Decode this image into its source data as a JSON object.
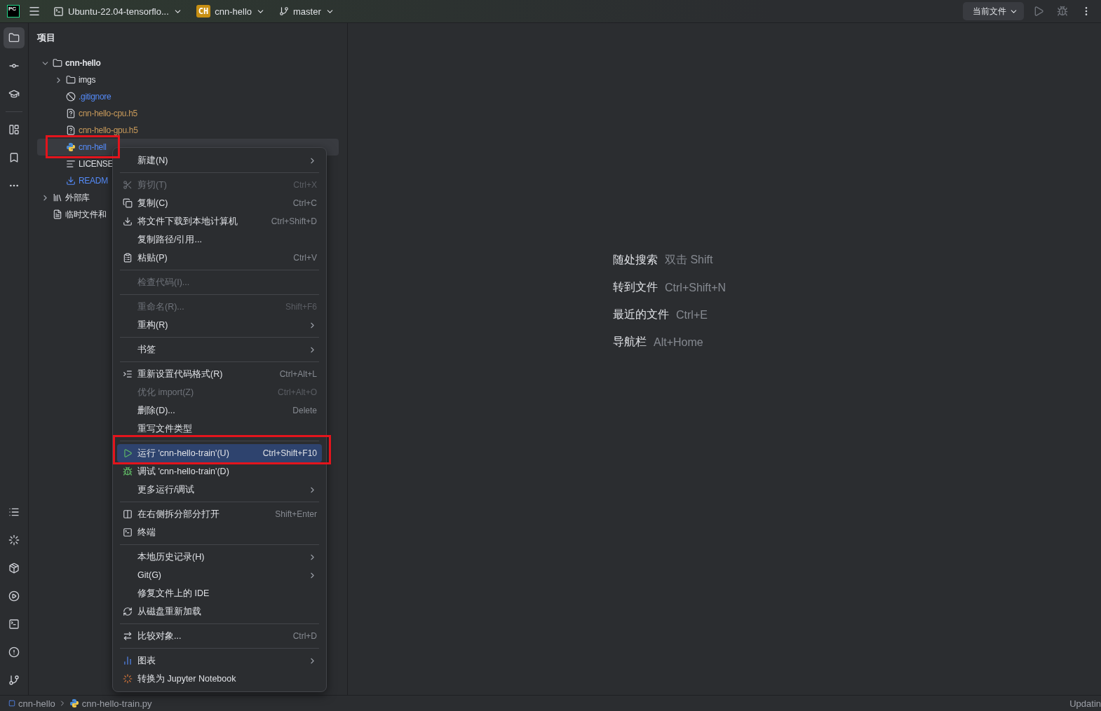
{
  "toolbar": {
    "logo": "PC",
    "environment": "Ubuntu-22.04-tensorflo...",
    "project_badge": "CH",
    "project": "cnn-hello",
    "branch": "master",
    "run_config": "当前文件"
  },
  "tool_strip": {
    "top": [
      {
        "selected": true
      },
      {
        "selected": false
      },
      {
        "selected": false
      },
      {
        "selected": false
      },
      {
        "selected": false
      },
      {
        "selected": false
      }
    ],
    "bottom": [
      {
        "selected": false
      },
      {
        "selected": false
      },
      {
        "selected": false
      },
      {
        "selected": false
      },
      {
        "selected": false
      },
      {
        "selected": false
      },
      {
        "selected": false
      }
    ]
  },
  "project_panel": {
    "title": "项目",
    "tree": [
      {
        "label": "cnn-hello",
        "kind": "folder",
        "bold": true,
        "selected": false,
        "expanded": true,
        "children": [
          {
            "label": "imgs",
            "kind": "folder",
            "selected": false,
            "expanded": false
          },
          {
            "label": ".gitignore",
            "kind": "ignore",
            "selected": false,
            "color": "#548af7"
          },
          {
            "label": "cnn-hello-cpu.h5",
            "kind": "unknown",
            "selected": false,
            "color": "#c7995a"
          },
          {
            "label": "cnn-hello-gpu.h5",
            "kind": "unknown",
            "selected": false,
            "color": "#c7995a"
          },
          {
            "label": "cnn-hell",
            "kind": "python",
            "selected": true,
            "color": "#548af7"
          },
          {
            "label": "LICENSE",
            "kind": "text",
            "selected": false,
            "color": "#dfe1e5"
          },
          {
            "label": "READM",
            "kind": "markdown",
            "selected": false,
            "color": "#548af7"
          }
        ]
      },
      {
        "label": "外部库",
        "kind": "library",
        "selected": false,
        "expanded": false
      },
      {
        "label": "临时文件和",
        "kind": "scratch",
        "selected": false
      }
    ]
  },
  "context_menu": [
    {
      "kind": "item",
      "label": "新建(N)",
      "submenu": true,
      "disabled": false,
      "selected": false
    },
    {
      "kind": "separator"
    },
    {
      "kind": "item",
      "label": "剪切(T)",
      "shortcut": "Ctrl+X",
      "disabled": true,
      "selected": false
    },
    {
      "kind": "item",
      "label": "复制(C)",
      "shortcut": "Ctrl+C",
      "disabled": false,
      "selected": false
    },
    {
      "kind": "item",
      "label": "将文件下载到本地计算机",
      "shortcut": "Ctrl+Shift+D",
      "disabled": false,
      "selected": false
    },
    {
      "kind": "item",
      "label": "复制路径/引用...",
      "disabled": false,
      "selected": false
    },
    {
      "kind": "item",
      "label": "粘贴(P)",
      "shortcut": "Ctrl+V",
      "disabled": false,
      "selected": false
    },
    {
      "kind": "separator"
    },
    {
      "kind": "item",
      "label": "检查代码(I)...",
      "disabled": true,
      "selected": false
    },
    {
      "kind": "separator"
    },
    {
      "kind": "item",
      "label": "重命名(R)...",
      "shortcut": "Shift+F6",
      "disabled": true,
      "selected": false
    },
    {
      "kind": "item",
      "label": "重构(R)",
      "submenu": true,
      "disabled": false,
      "selected": false
    },
    {
      "kind": "separator"
    },
    {
      "kind": "item",
      "label": "书签",
      "submenu": true,
      "disabled": false,
      "selected": false
    },
    {
      "kind": "separator"
    },
    {
      "kind": "item",
      "label": "重新设置代码格式(R)",
      "shortcut": "Ctrl+Alt+L",
      "disabled": false,
      "selected": false
    },
    {
      "kind": "item",
      "label": "优化 import(Z)",
      "shortcut": "Ctrl+Alt+O",
      "disabled": true,
      "selected": false
    },
    {
      "kind": "item",
      "label": "删除(D)...",
      "shortcut": "Delete",
      "disabled": false,
      "selected": false
    },
    {
      "kind": "item",
      "label": "重写文件类型",
      "disabled": false,
      "selected": false
    },
    {
      "kind": "separator"
    },
    {
      "kind": "item",
      "label": "运行 'cnn-hello-train'(U)",
      "shortcut": "Ctrl+Shift+F10",
      "disabled": false,
      "selected": true
    },
    {
      "kind": "item",
      "label": "调试 'cnn-hello-train'(D)",
      "disabled": false,
      "selected": false
    },
    {
      "kind": "item",
      "label": "更多运行/调试",
      "submenu": true,
      "disabled": false,
      "selected": false
    },
    {
      "kind": "separator"
    },
    {
      "kind": "item",
      "label": "在右侧拆分部分打开",
      "shortcut": "Shift+Enter",
      "disabled": false,
      "selected": false
    },
    {
      "kind": "item",
      "label": "终端",
      "disabled": false,
      "selected": false
    },
    {
      "kind": "separator"
    },
    {
      "kind": "item",
      "label": "本地历史记录(H)",
      "submenu": true,
      "disabled": false,
      "selected": false
    },
    {
      "kind": "item",
      "label": "Git(G)",
      "submenu": true,
      "disabled": false,
      "selected": false
    },
    {
      "kind": "item",
      "label": "修复文件上的 IDE",
      "disabled": false,
      "selected": false
    },
    {
      "kind": "item",
      "label": "从磁盘重新加载",
      "disabled": false,
      "selected": false
    },
    {
      "kind": "separator"
    },
    {
      "kind": "item",
      "label": "比较对象...",
      "shortcut": "Ctrl+D",
      "disabled": false,
      "selected": false
    },
    {
      "kind": "separator"
    },
    {
      "kind": "item",
      "label": "图表",
      "submenu": true,
      "disabled": false,
      "selected": false
    },
    {
      "kind": "item",
      "label": "转换为 Jupyter Notebook",
      "disabled": false,
      "selected": false
    }
  ],
  "editor_hints": [
    {
      "action": "随处搜索",
      "shortcut": "双击 Shift"
    },
    {
      "action": "转到文件",
      "shortcut": "Ctrl+Shift+N"
    },
    {
      "action": "最近的文件",
      "shortcut": "Ctrl+E"
    },
    {
      "action": "导航栏",
      "shortcut": "Alt+Home"
    }
  ],
  "status_bar": {
    "breadcrumbs": [
      "cnn-hello",
      "cnn-hello-train.py"
    ],
    "status": "Updatin"
  }
}
